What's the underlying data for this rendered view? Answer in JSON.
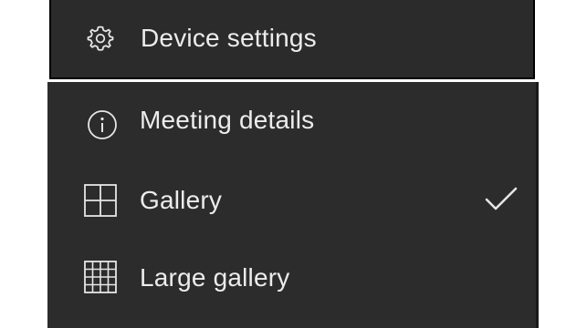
{
  "menu": {
    "device_settings": {
      "label": "Device settings",
      "icon": "gear-icon"
    },
    "items": [
      {
        "label": "Meeting details",
        "icon": "info-icon",
        "selected": false
      },
      {
        "label": "Gallery",
        "icon": "gallery-grid-icon",
        "selected": true
      },
      {
        "label": "Large gallery",
        "icon": "large-gallery-grid-icon",
        "selected": false
      }
    ],
    "selected_indicator_icon": "checkmark-icon"
  },
  "colors": {
    "menu_background": "#2d2c2c",
    "header_background": "#2b2b2b",
    "text": "#ececec",
    "page_background": "#ffffff"
  }
}
